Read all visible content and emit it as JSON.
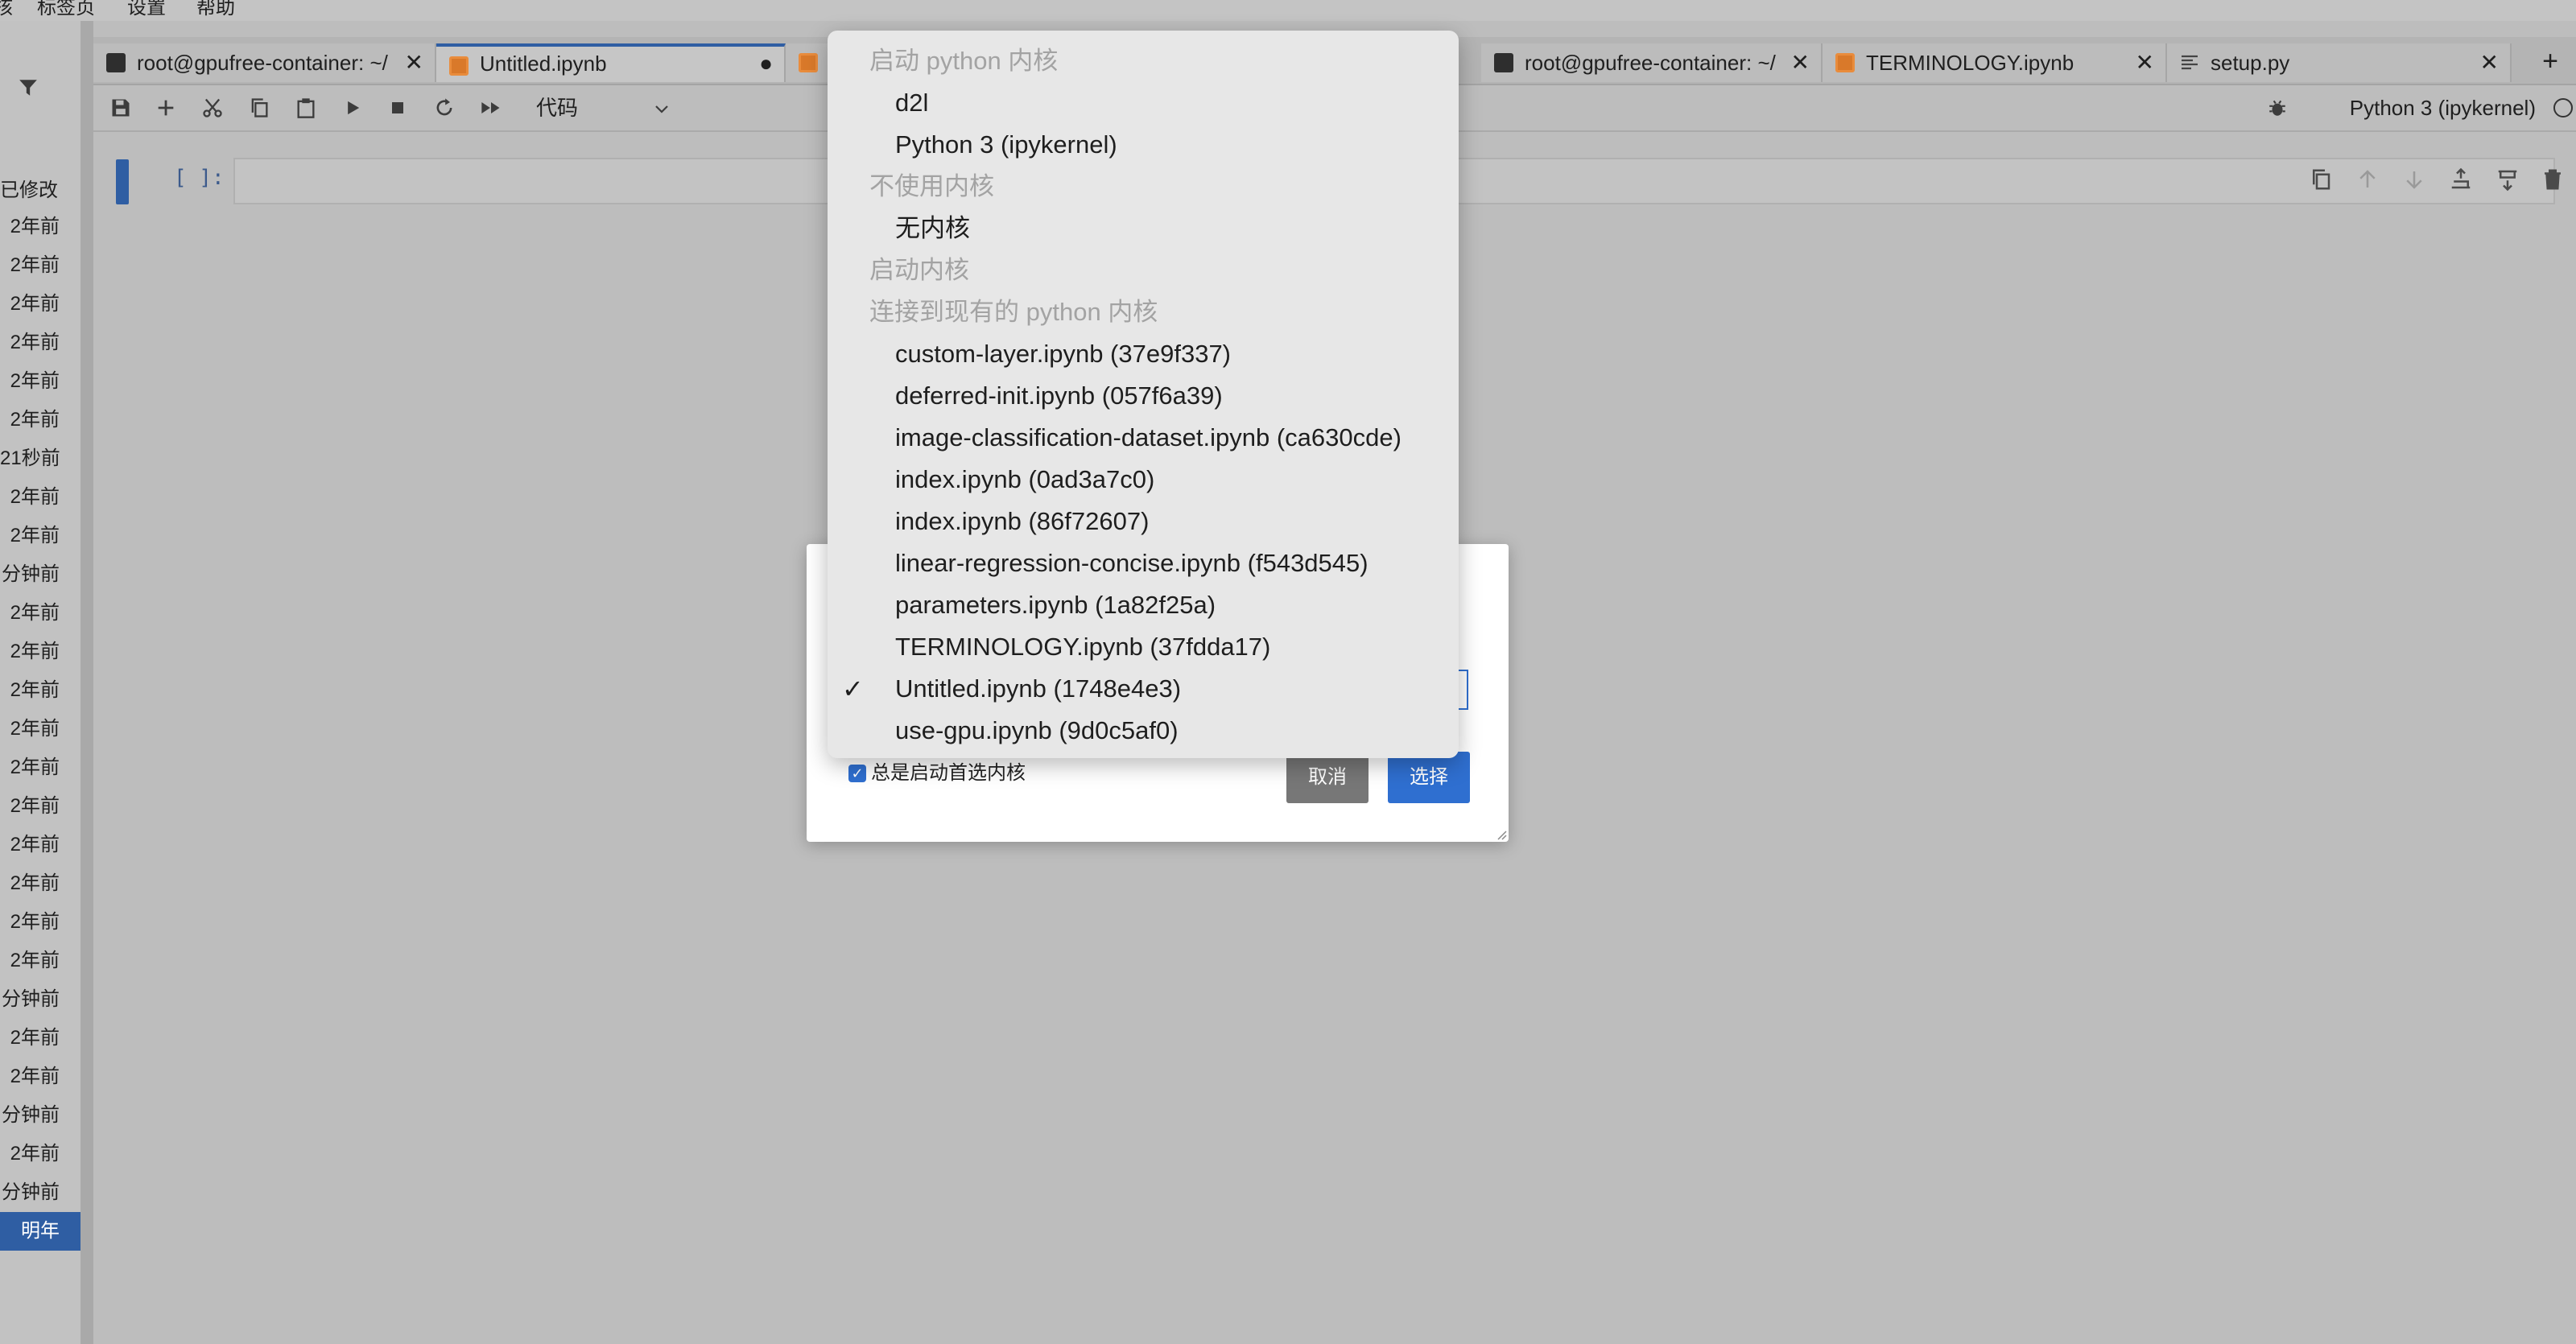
{
  "menubar": {
    "items": [
      "核",
      "标签页",
      "设置",
      "帮助"
    ]
  },
  "sidebar": {
    "column_header": "已修改",
    "rows": [
      "2年前",
      "2年前",
      "2年前",
      "2年前",
      "2年前",
      "2年前",
      "21秒前",
      "2年前",
      "2年前",
      "分钟前",
      "2年前",
      "2年前",
      "2年前",
      "2年前",
      "2年前",
      "2年前",
      "2年前",
      "2年前",
      "2年前",
      "2年前",
      "分钟前",
      "2年前",
      "2年前",
      "分钟前",
      "2年前",
      "分钟前",
      "明年"
    ],
    "selected_index": 26
  },
  "tabs": [
    {
      "label": "root@gpufree-container: ~/",
      "icon": "terminal-icon",
      "close": "✕",
      "active": false
    },
    {
      "label": "Untitled.ipynb",
      "icon": "notebook-icon",
      "close": "●",
      "active": true
    },
    {
      "label": "",
      "icon": "notebook-icon",
      "close": "",
      "active": false
    },
    {
      "label": "root@gpufree-container: ~/",
      "icon": "terminal-icon",
      "close": "✕",
      "active": false
    },
    {
      "label": "TERMINOLOGY.ipynb",
      "icon": "notebook-icon",
      "close": "✕",
      "active": false
    },
    {
      "label": "setup.py",
      "icon": "text-file-icon",
      "close": "✕",
      "active": false
    }
  ],
  "add_tab": "+",
  "toolbar": {
    "cell_type": "代码",
    "kernel_name": "Python 3 (ipykernel)"
  },
  "cell": {
    "prompt": "[ ]:",
    "input": ""
  },
  "dropdown": {
    "rows": [
      {
        "kind": "header",
        "text": "启动 python 内核"
      },
      {
        "kind": "item",
        "text": "d2l"
      },
      {
        "kind": "item",
        "text": "Python 3 (ipykernel)"
      },
      {
        "kind": "header",
        "text": "不使用内核"
      },
      {
        "kind": "item",
        "text": "无内核"
      },
      {
        "kind": "header",
        "text": "启动内核"
      },
      {
        "kind": "header",
        "text": "连接到现有的 python 内核"
      },
      {
        "kind": "item",
        "text": "custom-layer.ipynb (37e9f337)"
      },
      {
        "kind": "item",
        "text": "deferred-init.ipynb (057f6a39)"
      },
      {
        "kind": "item",
        "text": "image-classification-dataset.ipynb (ca630cde)"
      },
      {
        "kind": "item",
        "text": "index.ipynb (0ad3a7c0)"
      },
      {
        "kind": "item",
        "text": "index.ipynb (86f72607)"
      },
      {
        "kind": "item",
        "text": "linear-regression-concise.ipynb (f543d545)"
      },
      {
        "kind": "item",
        "text": "parameters.ipynb (1a82f25a)"
      },
      {
        "kind": "item",
        "text": "TERMINOLOGY.ipynb (37fdda17)"
      },
      {
        "kind": "item",
        "text": "Untitled.ipynb (1748e4e3)",
        "checked": true
      },
      {
        "kind": "item",
        "text": "use-gpu.ipynb (9d0c5af0)"
      }
    ],
    "check_glyph": "✓"
  },
  "dialog": {
    "checkbox_label": "总是启动首选内核",
    "checkbox_checked": true,
    "checkbox_glyph": "✓",
    "cancel_label": "取消",
    "select_label": "选择"
  },
  "colors": {
    "accent": "#2f5ea3",
    "primary_button": "#2f6fd0",
    "header_text": "#a3a3a3",
    "notebook_icon": "#d9792a"
  }
}
